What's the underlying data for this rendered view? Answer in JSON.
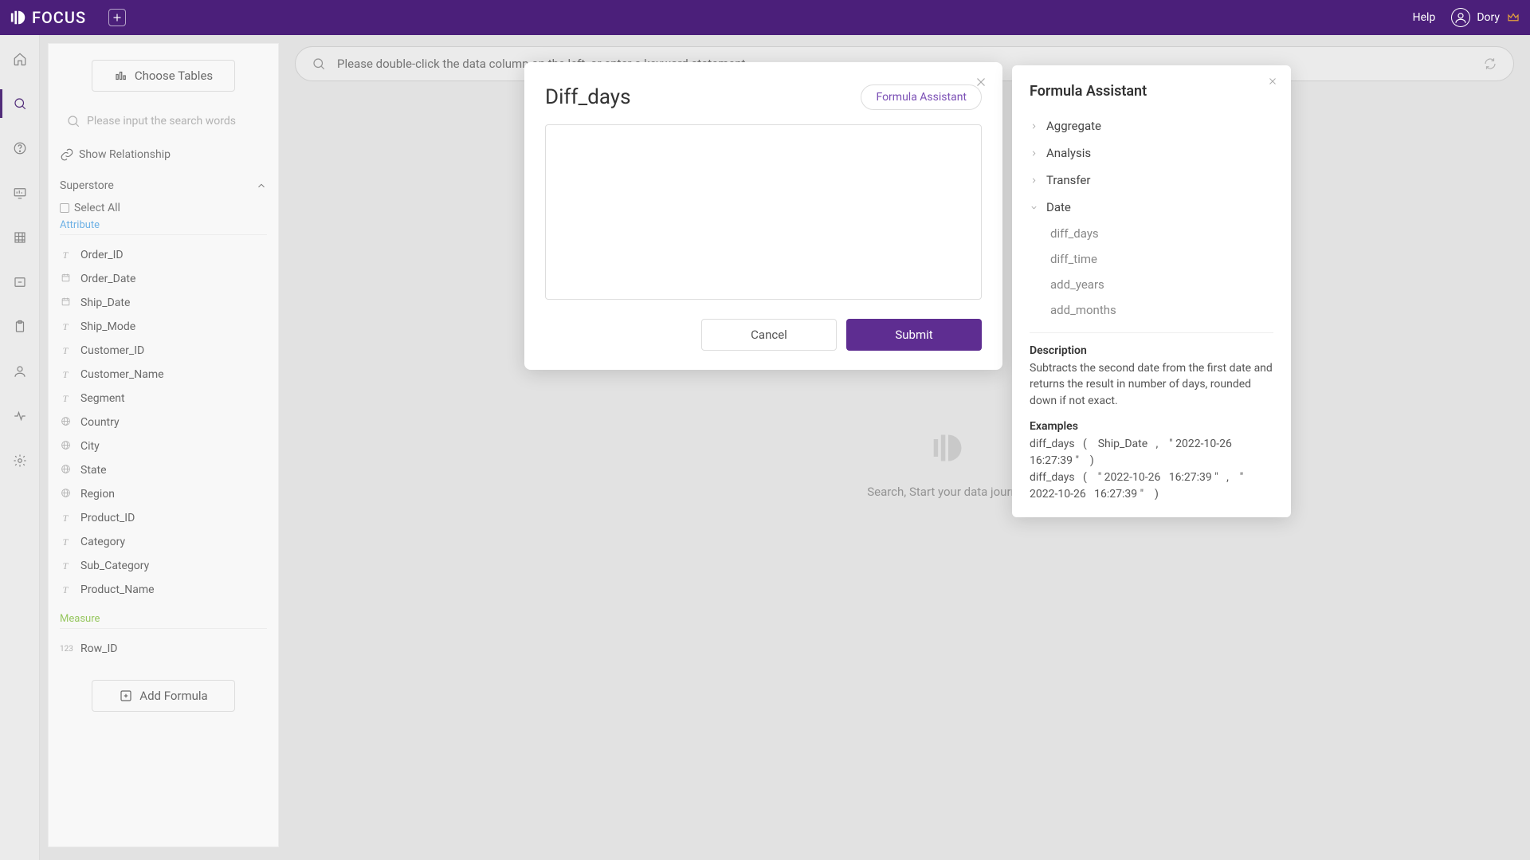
{
  "header": {
    "brand": "FOCUS",
    "help": "Help",
    "user": "Dory"
  },
  "sidebar": {
    "choose_tables": "Choose Tables",
    "search_placeholder": "Please input the search words",
    "show_relationship": "Show Relationship",
    "datasource": "Superstore",
    "select_all": "Select All",
    "attribute_label": "Attribute",
    "measure_label": "Measure",
    "attributes": [
      {
        "name": "Order_ID",
        "icon": "T"
      },
      {
        "name": "Order_Date",
        "icon": "cal"
      },
      {
        "name": "Ship_Date",
        "icon": "cal"
      },
      {
        "name": "Ship_Mode",
        "icon": "T"
      },
      {
        "name": "Customer_ID",
        "icon": "T"
      },
      {
        "name": "Customer_Name",
        "icon": "T"
      },
      {
        "name": "Segment",
        "icon": "T"
      },
      {
        "name": "Country",
        "icon": "geo"
      },
      {
        "name": "City",
        "icon": "geo"
      },
      {
        "name": "State",
        "icon": "geo"
      },
      {
        "name": "Region",
        "icon": "geo"
      },
      {
        "name": "Product_ID",
        "icon": "T"
      },
      {
        "name": "Category",
        "icon": "T"
      },
      {
        "name": "Sub_Category",
        "icon": "T"
      },
      {
        "name": "Product_Name",
        "icon": "T"
      }
    ],
    "measures": [
      {
        "name": "Row_ID",
        "icon": "123"
      }
    ],
    "add_formula": "Add Formula"
  },
  "main": {
    "search_placeholder": "Please double-click the data column on the left, or enter a keyword statement",
    "empty_text": "Search, Start your data journey"
  },
  "modal": {
    "title": "Diff_days",
    "assist_button": "Formula Assistant",
    "cancel": "Cancel",
    "submit": "Submit"
  },
  "assist": {
    "title": "Formula Assistant",
    "categories": [
      "Aggregate",
      "Analysis",
      "Transfer",
      "Date"
    ],
    "expanded_category": "Date",
    "date_functions": [
      "diff_days",
      "diff_time",
      "add_years",
      "add_months"
    ],
    "desc_h": "Description",
    "desc_p": "Subtracts the second date from the first date and returns the result in number of days, rounded down if not exact.",
    "ex_h": "Examples",
    "ex_p": "diff_days   (    Ship_Date   ,    \" 2022-10-26   16:27:39 \"    )\ndiff_days   (    \" 2022-10-26   16:27:39 \"   ,    \" 2022-10-26   16:27:39 \"    )"
  }
}
